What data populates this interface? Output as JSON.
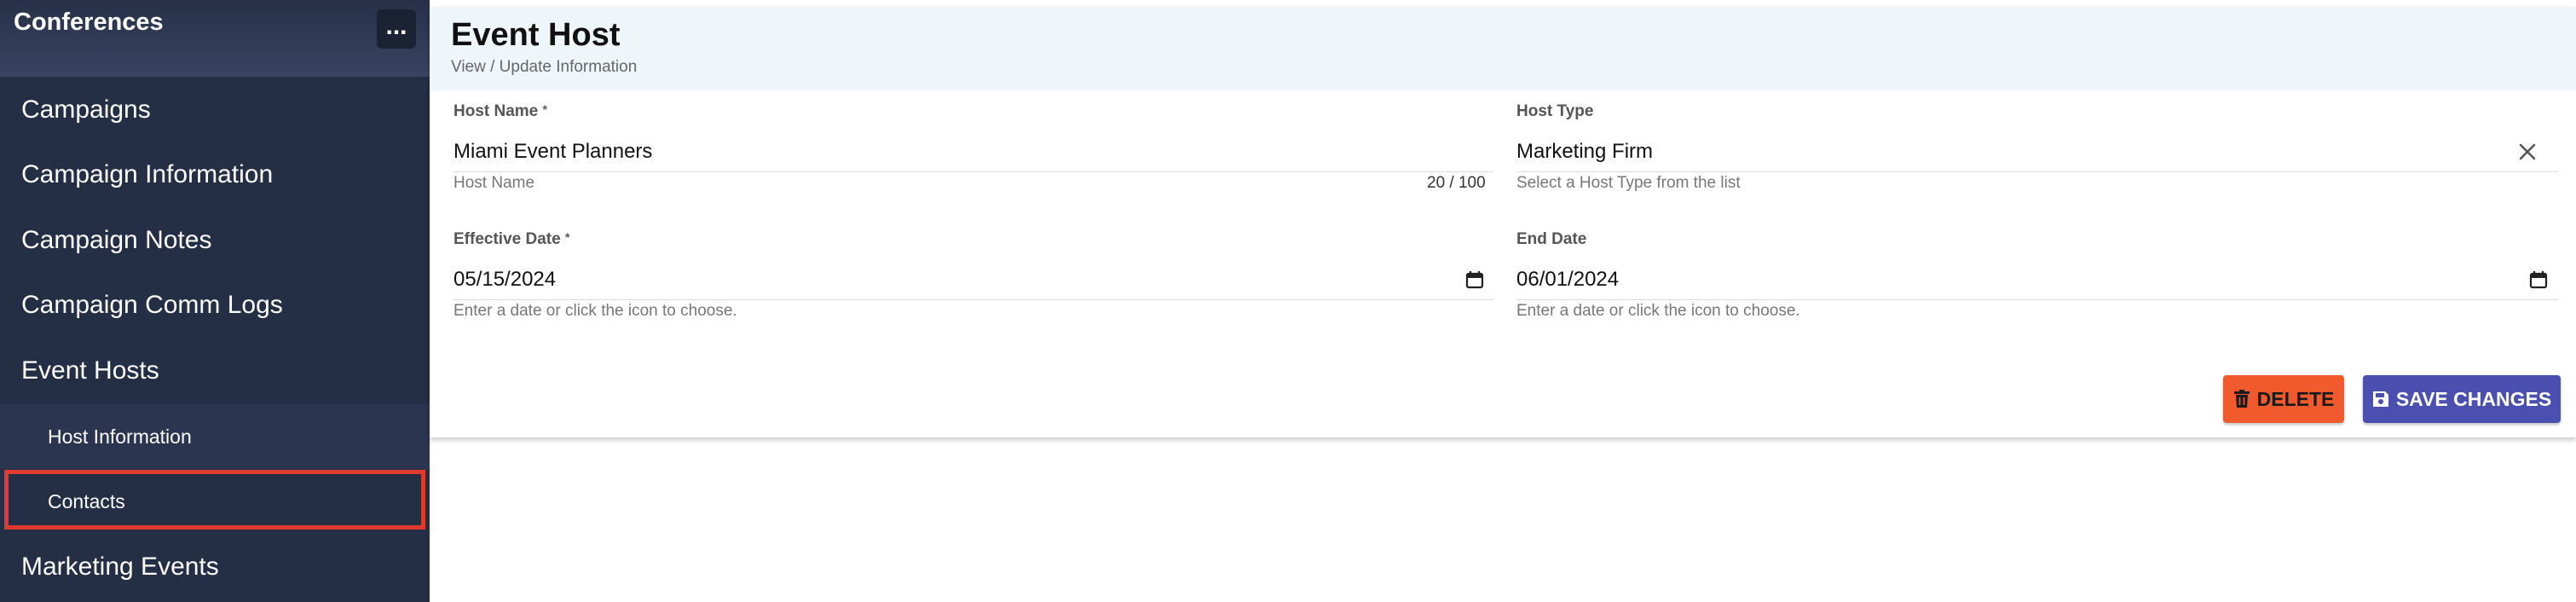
{
  "sidebar": {
    "title": "Conferences",
    "more_label": "...",
    "items": [
      {
        "label": "Campaigns"
      },
      {
        "label": "Campaign Information"
      },
      {
        "label": "Campaign Notes"
      },
      {
        "label": "Campaign Comm Logs"
      },
      {
        "label": "Event Hosts"
      },
      {
        "label": "Host Information"
      },
      {
        "label": "Contacts"
      },
      {
        "label": "Marketing Events"
      }
    ]
  },
  "page": {
    "title": "Event Host",
    "subtitle": "View / Update Information"
  },
  "form": {
    "host_name": {
      "label": "Host Name",
      "required_mark": "*",
      "value": "Miami Event Planners",
      "hint": "Host Name",
      "counter": "20 / 100"
    },
    "host_type": {
      "label": "Host Type",
      "value": "Marketing Firm",
      "hint": "Select a Host Type from the list"
    },
    "effective_date": {
      "label": "Effective Date",
      "required_mark": "*",
      "value": "05/15/2024",
      "hint": "Enter a date or click the icon to choose."
    },
    "end_date": {
      "label": "End Date",
      "value": "06/01/2024",
      "hint": "Enter a date or click the icon to choose."
    }
  },
  "actions": {
    "delete_label": "DELETE",
    "save_label": "SAVE CHANGES"
  },
  "colors": {
    "sidebar_bg": "#242e45",
    "highlight": "#e03a2e",
    "delete": "#f05a2d",
    "save": "#4a4fb0"
  },
  "icons": {
    "clear": "close-icon",
    "calendar": "calendar-icon",
    "delete": "trash-icon",
    "save": "save-icon"
  }
}
